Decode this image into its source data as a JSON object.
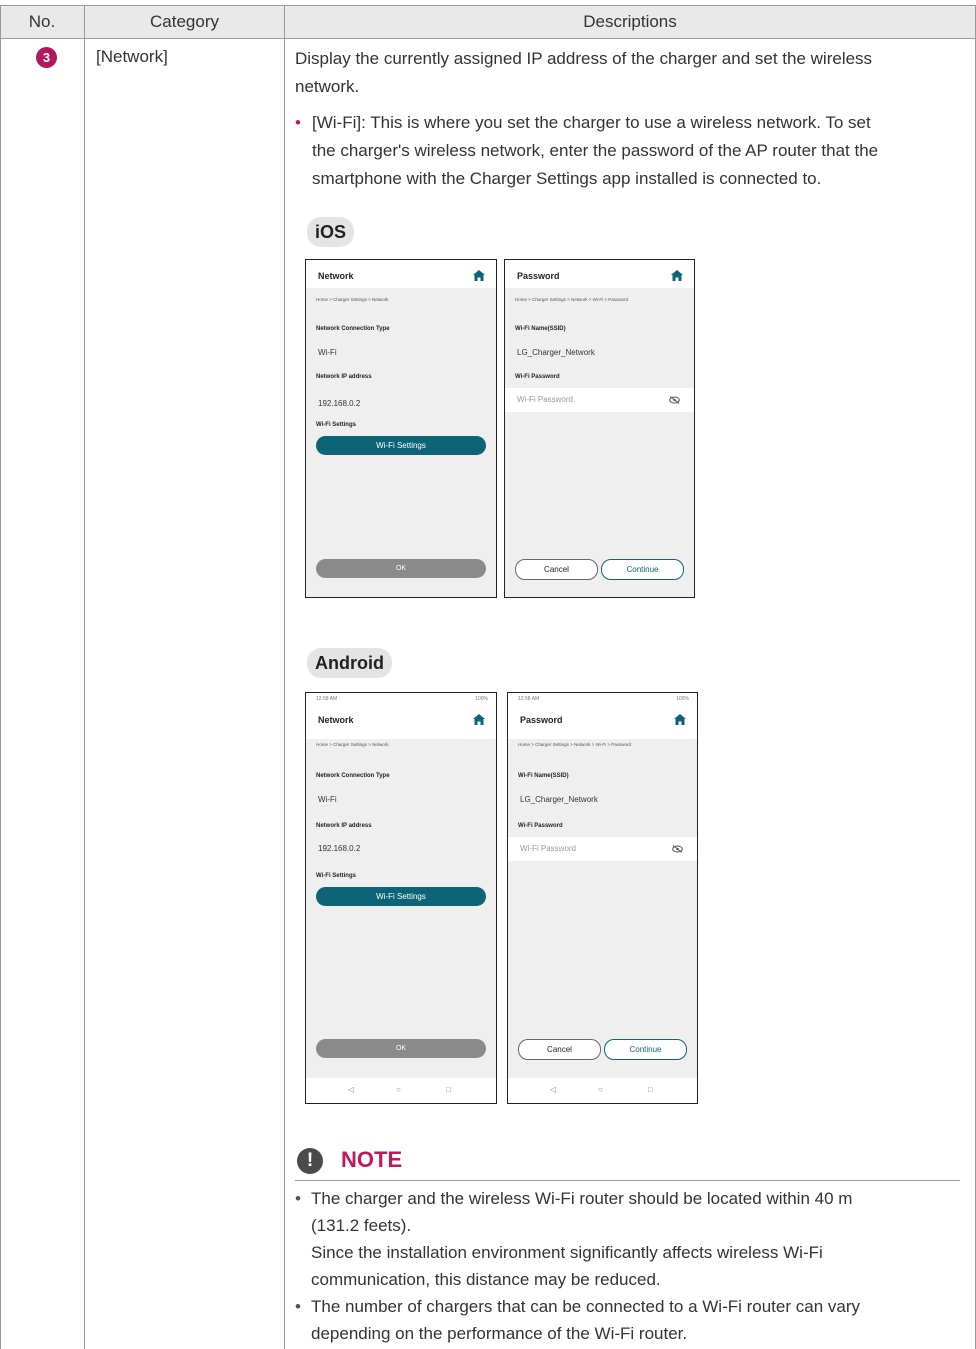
{
  "table": {
    "headers": [
      "No.",
      "Category",
      "Descriptions"
    ]
  },
  "row": {
    "number": "3",
    "category": "[Network]",
    "intro_line1": "Display the currently assigned IP address of the charger and set the wireless",
    "intro_line2": "network.",
    "bullet": "•",
    "wifi_line1": "[Wi-Fi]: This is where you set the charger to use a wireless network. To set",
    "wifi_line2": "the charger's wireless network, enter the password of the AP router that the",
    "wifi_line3": "smartphone with the Charger Settings app installed is connected to."
  },
  "ios": {
    "label": "iOS",
    "network_screen": {
      "title": "Network",
      "breadcrumb": "Home > Charger Settings > Network",
      "conn_type_label": "Network Connection Type",
      "conn_type_value": "Wi-Fi",
      "ip_label": "Network IP address",
      "ip_value": "192.168.0.2",
      "wifi_settings_label": "Wi-Fi Settings",
      "wifi_settings_button": "Wi-Fi Settings",
      "ok_button": "OK"
    },
    "password_screen": {
      "title": "Password",
      "breadcrumb": "Home > Charger Settings > Network > Wi-Fi > Password",
      "ssid_label": "Wi-Fi Name(SSID)",
      "ssid_value": "LG_Charger_Network",
      "pw_label": "Wi-Fi Password",
      "pw_placeholder": "Wi-Fi Password",
      "cancel_button": "Cancel",
      "continue_button": "Continue"
    }
  },
  "android": {
    "label": "Android",
    "status_time": "12:58 AM",
    "status_battery": "100%",
    "network_screen": {
      "title": "Network",
      "breadcrumb": "Home > Charger Settings > Network",
      "conn_type_label": "Network Connection Type",
      "conn_type_value": "Wi-Fi",
      "ip_label": "Network IP address",
      "ip_value": "192.168.0.2",
      "wifi_settings_label": "Wi-Fi Settings",
      "wifi_settings_button": "Wi-Fi Settings",
      "ok_button": "OK"
    },
    "password_screen": {
      "title": "Password",
      "breadcrumb": "Home > Charger Settings > Network > Wi-Fi > Password",
      "ssid_label": "Wi-Fi Name(SSID)",
      "ssid_value": "LG_Charger_Network",
      "pw_label": "Wi-Fi Password",
      "pw_placeholder": "Wi-Fi Password",
      "cancel_button": "Cancel",
      "continue_button": "Continue"
    },
    "nav_back": "◁",
    "nav_home": "○",
    "nav_recent": "□"
  },
  "note": {
    "icon": "!",
    "title": "NOTE",
    "bullet": "•",
    "item1_line1": "The charger and the wireless Wi-Fi router should be located within 40 m",
    "item1_line2": "(131.2 feets).",
    "item1_line3": "Since the installation environment significantly affects wireless Wi-Fi",
    "item1_line4": "communication, this distance may be reduced.",
    "item2_line1": "The number of chargers that can be connected to a Wi-Fi router can vary",
    "item2_line2": "depending on the performance of the Wi-Fi router."
  },
  "colors": {
    "accent_pink": "#c0185e",
    "teal_button": "#0d6476",
    "header_bg": "#e9e9e9"
  }
}
